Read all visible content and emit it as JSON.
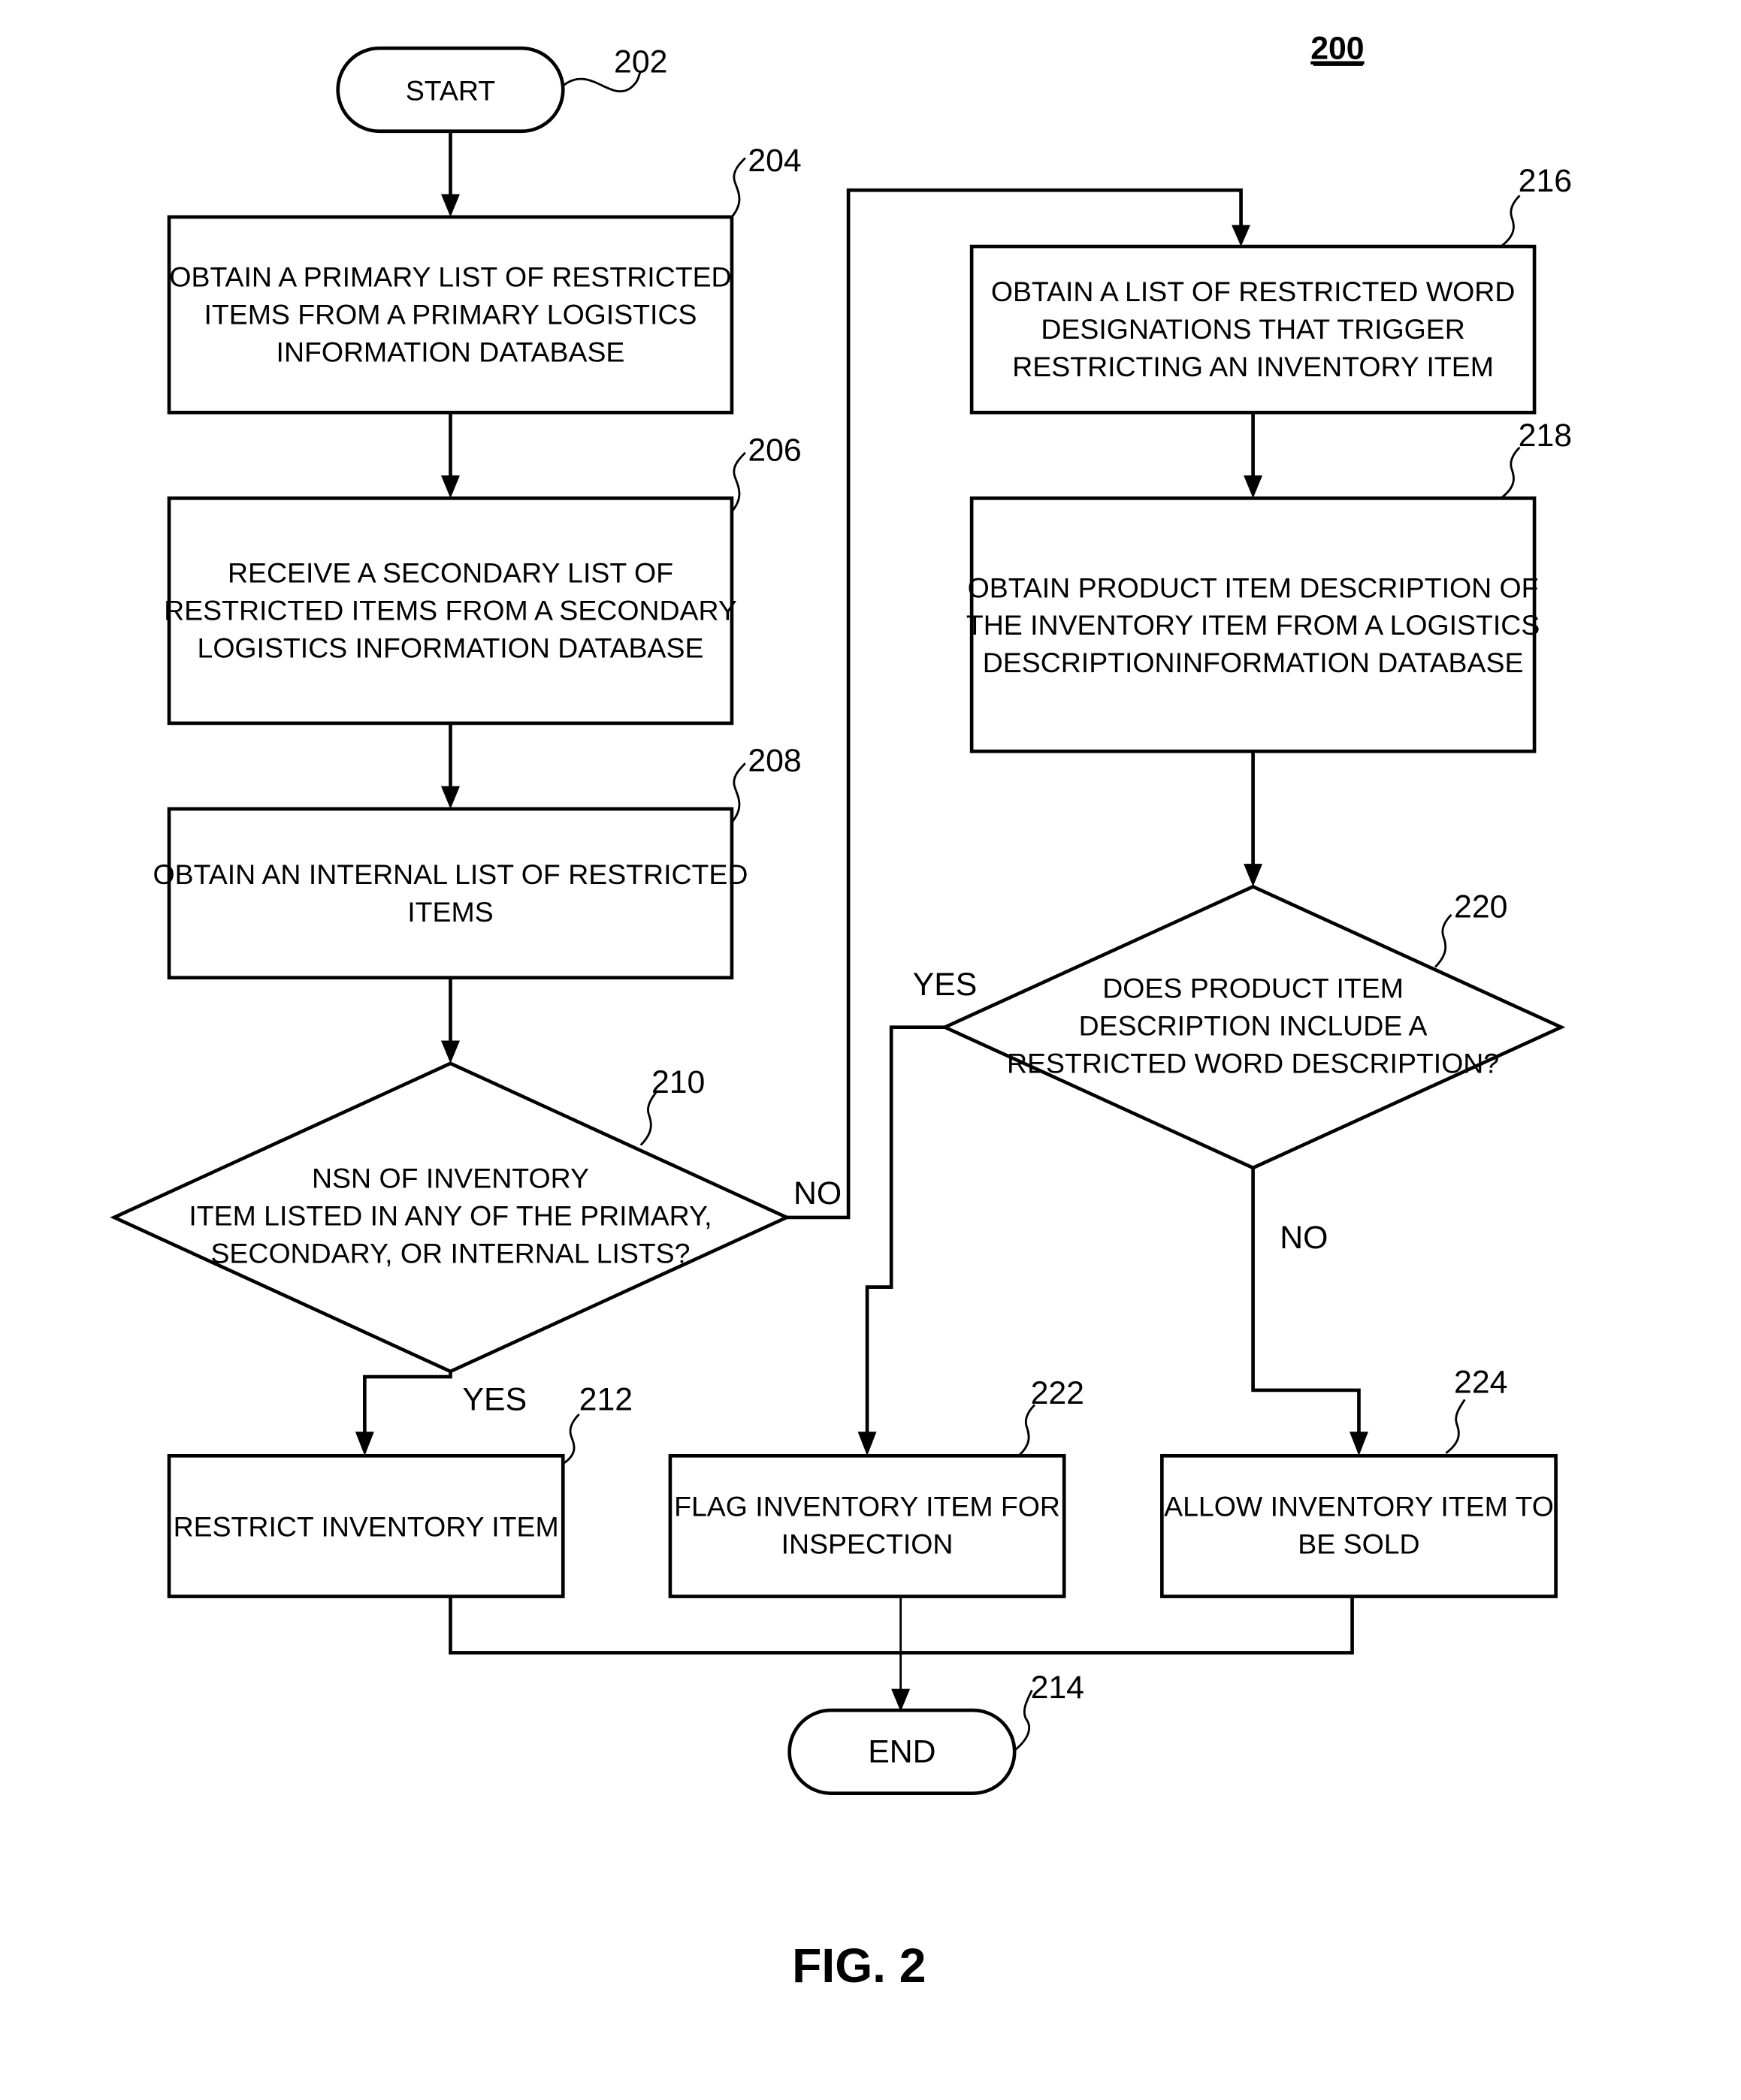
{
  "figure": {
    "number_label": "200",
    "caption": "FIG. 2"
  },
  "nodes": {
    "start": {
      "ref": "202",
      "label": "START"
    },
    "n204": {
      "ref": "204",
      "lines": [
        "OBTAIN A PRIMARY LIST OF RESTRICTED",
        "ITEMS FROM A PRIMARY LOGISTICS",
        "INFORMATION DATABASE"
      ]
    },
    "n206": {
      "ref": "206",
      "lines": [
        "RECEIVE A SECONDARY LIST OF",
        "RESTRICTED ITEMS FROM A SECONDARY",
        "LOGISTICS INFORMATION DATABASE"
      ]
    },
    "n208": {
      "ref": "208",
      "lines": [
        "OBTAIN AN INTERNAL LIST OF RESTRICTED",
        "ITEMS"
      ]
    },
    "n210": {
      "ref": "210",
      "lines": [
        "NSN OF INVENTORY",
        "ITEM LISTED IN ANY OF THE PRIMARY,",
        "SECONDARY, OR INTERNAL LISTS?"
      ]
    },
    "n212": {
      "ref": "212",
      "lines": [
        "RESTRICT INVENTORY ITEM"
      ]
    },
    "end": {
      "ref": "214",
      "label": "END"
    },
    "n216": {
      "ref": "216",
      "lines": [
        "OBTAIN A LIST OF RESTRICTED WORD",
        "DESIGNATIONS THAT TRIGGER",
        "RESTRICTING AN INVENTORY ITEM"
      ]
    },
    "n218": {
      "ref": "218",
      "lines": [
        "OBTAIN PRODUCT ITEM DESCRIPTION OF",
        "THE INVENTORY ITEM FROM A LOGISTICS",
        "DESCRIPTIONINFORMATION DATABASE"
      ]
    },
    "n220": {
      "ref": "220",
      "lines": [
        "DOES PRODUCT ITEM",
        "DESCRIPTION INCLUDE A",
        "RESTRICTED WORD DESCRIPTION?"
      ]
    },
    "n222": {
      "ref": "222",
      "lines": [
        "FLAG INVENTORY ITEM FOR",
        "INSPECTION"
      ]
    },
    "n224": {
      "ref": "224",
      "lines": [
        "ALLOW INVENTORY ITEM TO",
        "BE SOLD"
      ]
    }
  },
  "edges": {
    "n210_no": "NO",
    "n210_yes": "YES",
    "n220_yes": "YES",
    "n220_no": "NO"
  }
}
